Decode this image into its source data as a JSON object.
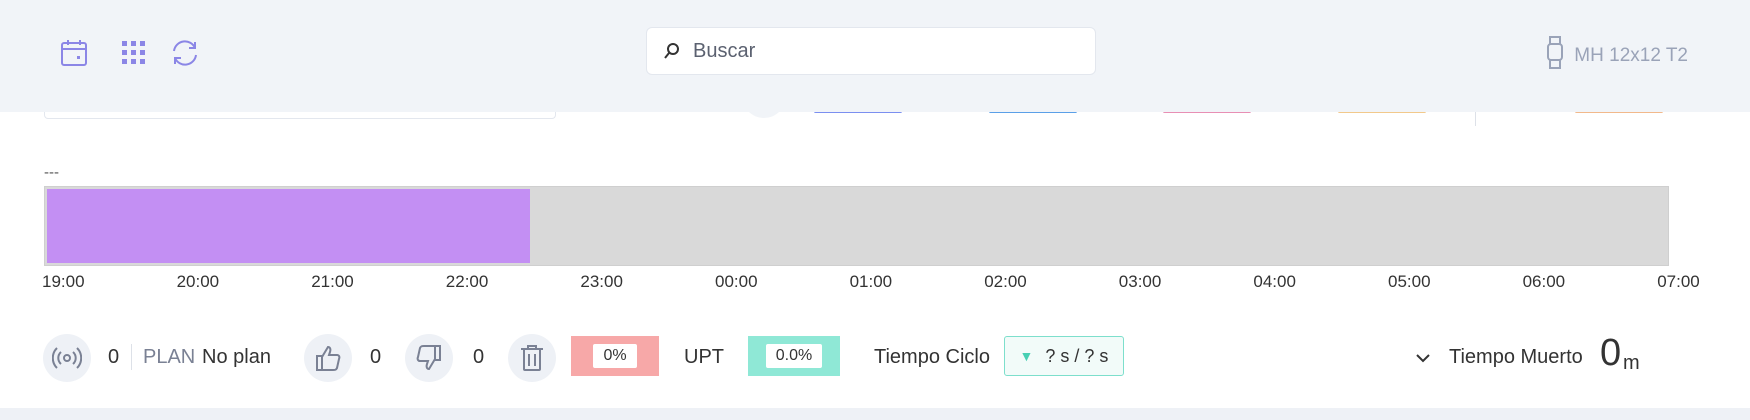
{
  "header": {
    "search_placeholder": "Buscar",
    "device_name": "MH 12x12 T2",
    "icons": [
      "calendar-icon",
      "grid-icon",
      "refresh-icon",
      "watch-icon",
      "search-icon"
    ]
  },
  "timeline": {
    "label": "---",
    "start": "19:00",
    "end": "07:00",
    "filled_until": "22:30",
    "fill_fraction": 0.298,
    "fill_color": "#c38ff3",
    "track_color": "#d9d9d9",
    "ticks": [
      "19:00",
      "20:00",
      "21:00",
      "22:00",
      "23:00",
      "00:00",
      "01:00",
      "02:00",
      "03:00",
      "04:00",
      "05:00",
      "06:00",
      "07:00"
    ]
  },
  "peek": {
    "line_colors": [
      "#7b8ff0",
      "#5ba0e8",
      "#e88fb4",
      "#f2c98b",
      "#f2b98b"
    ]
  },
  "stats": {
    "signal_count": "0",
    "plan_label": "PLAN",
    "plan_value": "No plan",
    "thumbs_up_count": "0",
    "thumbs_down_count": "0",
    "scrap_percent": "0%",
    "scrap_color": "#f7a8a8",
    "upt_label": "UPT",
    "upt_value": "0.0%",
    "upt_color": "#8fe8d6",
    "cycle_label": "Tiempo Ciclo",
    "cycle_value": "? s / ? s",
    "dead_label": "Tiempo Muerto",
    "dead_value": "0",
    "dead_unit": "m"
  }
}
